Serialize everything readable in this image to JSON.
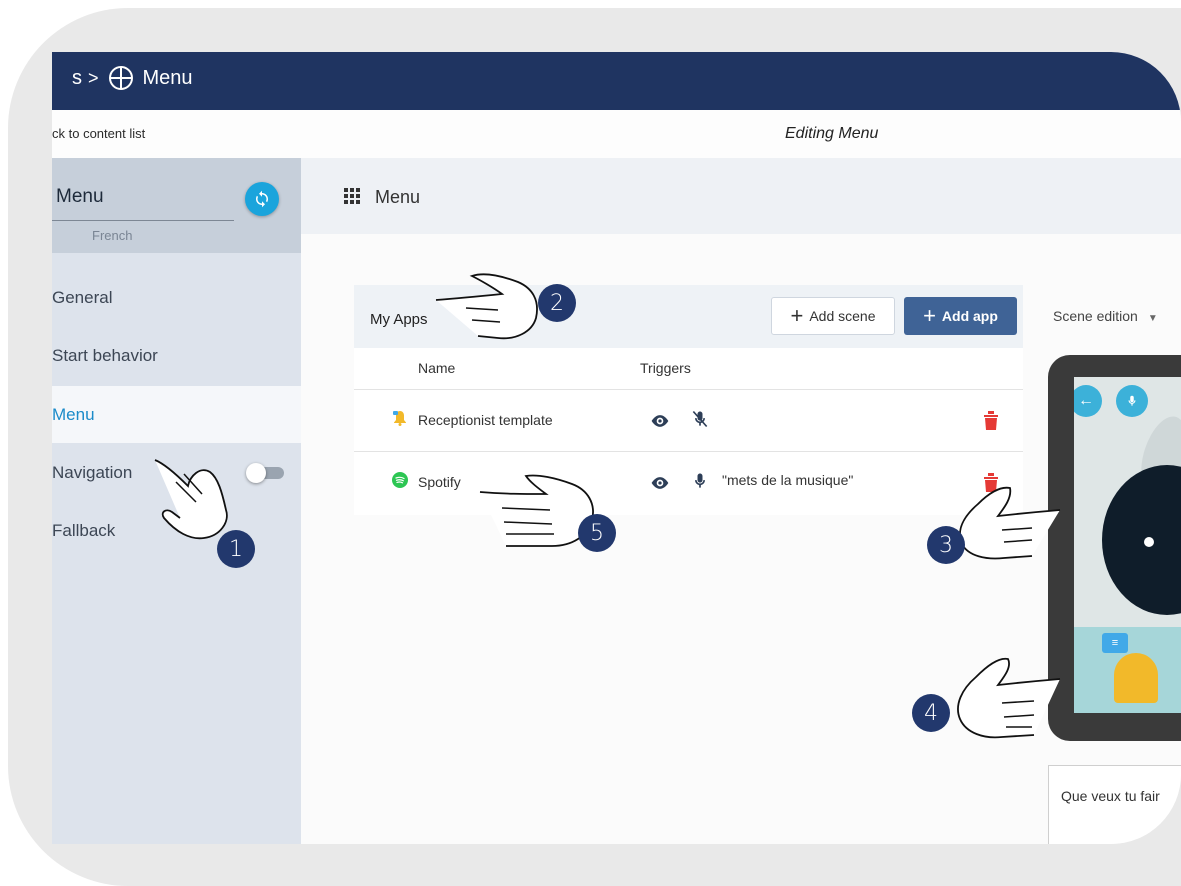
{
  "header": {
    "crumb_prefix": "s",
    "crumb_sep": ">",
    "crumb_current": "Menu"
  },
  "subbar": {
    "back_link": "ck to content list",
    "editing_title": "Editing Menu"
  },
  "sidebar": {
    "title": "Menu",
    "language": "French",
    "items": [
      {
        "label": "General"
      },
      {
        "label": "Start behavior"
      },
      {
        "label": "Menu"
      },
      {
        "label": "Navigation"
      },
      {
        "label": "Fallback"
      }
    ],
    "navigation_toggle_on": false
  },
  "content": {
    "title": "Menu"
  },
  "apps": {
    "card_title": "My Apps",
    "add_scene": "Add scene",
    "add_app": "Add app",
    "columns": {
      "name": "Name",
      "triggers": "Triggers"
    },
    "rows": [
      {
        "name": "Receptionist template",
        "icon": "bell-icon",
        "mic_enabled": false,
        "trigger_text": ""
      },
      {
        "name": "Spotify",
        "icon": "spotify-icon",
        "mic_enabled": true,
        "trigger_text": "\"mets de la musique\""
      }
    ]
  },
  "preview": {
    "scene_select": "Scene edition",
    "prompt_text": "Que veux tu fair"
  },
  "callouts": [
    "1",
    "2",
    "3",
    "4",
    "5"
  ],
  "colors": {
    "topbar": "#1f3461",
    "accent": "#1aa4dc",
    "primary_button": "#3f6396",
    "delete": "#e53935"
  }
}
